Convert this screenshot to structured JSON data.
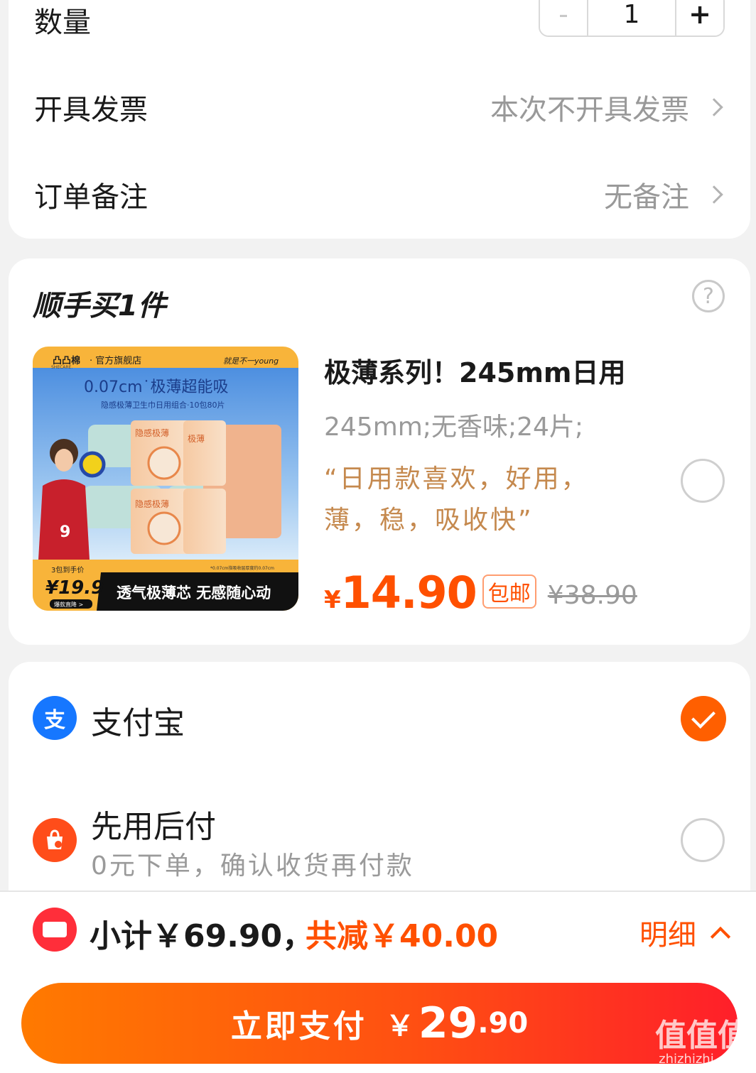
{
  "options": {
    "quantity_label": "数量",
    "quantity_minus": "-",
    "quantity_value": "1",
    "quantity_plus": "+",
    "invoice_label": "开具发票",
    "invoice_value": "本次不开具发票",
    "remark_label": "订单备注",
    "remark_value": "无备注"
  },
  "addon": {
    "title": "顺手买1件",
    "help_symbol": "?",
    "product": {
      "name": "极薄系列！245mm日用",
      "spec": "245mm;无香味;24片;",
      "review": "“日用款喜欢，好用，薄，稳，吸收快”",
      "price_symbol": "¥",
      "price": "14.90",
      "shipping_badge": "包邮",
      "original_price": "¥38.90",
      "image": {
        "brand": "凸凸棉",
        "brand_en": "SHECARE.",
        "store": "· 官方旗舰店",
        "slogan": "就是不一young",
        "headline": "0.07cm˙极薄超能吸",
        "subline": "隐感极薄卫生巾日用组合·10包80片",
        "pack_text_a": "隐感极薄",
        "pack_text_b": "极薄",
        "jersey_number": "9",
        "promo_top": "3包到手价",
        "promo_price": "¥19.9",
        "promo_tag": "爆款直降 >",
        "banner": "透气极薄芯 无感随心动",
        "footnote": "*0.07cm指吸收层厚度约0.07cm"
      }
    }
  },
  "payment": {
    "methods": [
      {
        "label": "支付宝",
        "icon": "alipay-icon",
        "icon_glyph": "支",
        "color": "#1677ff",
        "selected": true
      },
      {
        "label": "先用后付",
        "sub": "0元下单，确认收货再付款",
        "icon": "shopping-bag-icon",
        "color": "#ff4d1a",
        "selected": false
      }
    ]
  },
  "summary": {
    "subtotal": "小计￥69.90，",
    "discount": "共减￥40.00",
    "detail_label": "明细"
  },
  "pay_button": {
    "label": "立即支付",
    "currency": "￥",
    "amount_int": "29",
    "amount_dec": ".90"
  },
  "watermark": {
    "text": "值值值",
    "domain": "zhizhizhi.com"
  },
  "colors": {
    "accent": "#ff5000",
    "review": "#c5894e",
    "alipay": "#1677ff"
  }
}
